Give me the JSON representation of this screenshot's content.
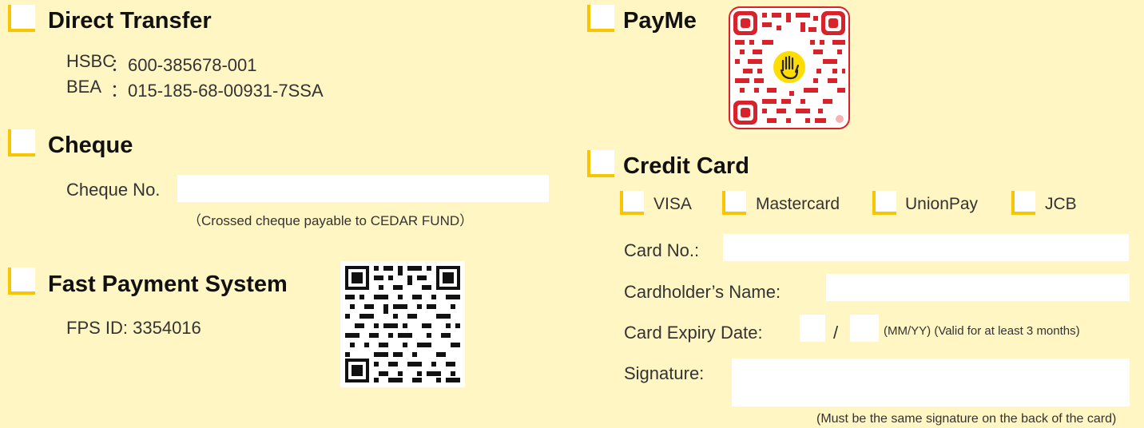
{
  "direct_transfer": {
    "heading": "Direct Transfer",
    "hsbc_label": "HSBC",
    "hsbc_value": "：600-385678-001",
    "bea_label": "BEA",
    "bea_value": "：015-185-68-00931-7SSA"
  },
  "cheque": {
    "heading": "Cheque",
    "number_label": "Cheque No.",
    "note": "（Crossed cheque payable to CEDAR FUND）"
  },
  "fps": {
    "heading": "Fast Payment System",
    "id_text": "FPS ID: 3354016"
  },
  "payme": {
    "heading": "PayMe"
  },
  "credit_card": {
    "heading": "Credit Card",
    "brands": [
      "VISA",
      "Mastercard",
      "UnionPay",
      "JCB"
    ],
    "card_no_label": "Card No.:",
    "cardholder_label": "Cardholder’s Name:",
    "expiry_label": "Card Expiry Date:",
    "expiry_separator": "/",
    "expiry_note": "(MM/YY) (Valid for at least 3 months)",
    "signature_label": "Signature:",
    "signature_note": "(Must be the same signature on the back of the card)"
  },
  "colors": {
    "background": "#fff6c3",
    "checkbox_accent": "#f7c600",
    "payme_red": "#d8232a",
    "payme_logo_yellow": "#ffdd00"
  }
}
